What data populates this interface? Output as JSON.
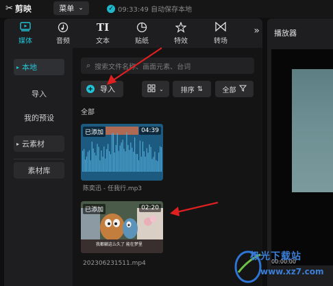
{
  "titlebar": {
    "app_name": "剪映",
    "menu_label": "菜单",
    "autosave_text": "09:33:49 自动保存本地"
  },
  "toolbar": {
    "tools": [
      {
        "label": "媒体",
        "icon": "media-icon",
        "active": true
      },
      {
        "label": "音频",
        "icon": "audio-icon",
        "active": false
      },
      {
        "label": "文本",
        "icon": "text-icon",
        "active": false
      },
      {
        "label": "贴纸",
        "icon": "sticker-icon",
        "active": false
      },
      {
        "label": "特效",
        "icon": "effects-icon",
        "active": false
      },
      {
        "label": "转场",
        "icon": "transition-icon",
        "active": false
      }
    ],
    "more": "»"
  },
  "nav": {
    "local": "本地",
    "import": "导入",
    "my_presets": "我的预设",
    "cloud": "云素材",
    "library": "素材库"
  },
  "search": {
    "placeholder": "搜索文件名称、画面元素、台词"
  },
  "controls": {
    "import_label": "导入",
    "sort_label": "排序",
    "filter_label": "全部"
  },
  "section_title": "全部",
  "media": [
    {
      "badge": "已添加",
      "duration": "04:39",
      "name": "陈奕迅 - 任我行.mp3",
      "kind": "audio"
    },
    {
      "badge": "已添加",
      "duration": "02:20",
      "name": "202306231511.mp4",
      "kind": "video",
      "subtitle": "我都躺这么久了 能在梦里"
    }
  ],
  "player": {
    "title": "播放器",
    "timecode": "00:00:00"
  },
  "watermark": {
    "text": "极光下载站",
    "url": "www.xz7.com"
  },
  "colors": {
    "accent": "#21c3d6",
    "annotation_arrow": "#e02020"
  }
}
